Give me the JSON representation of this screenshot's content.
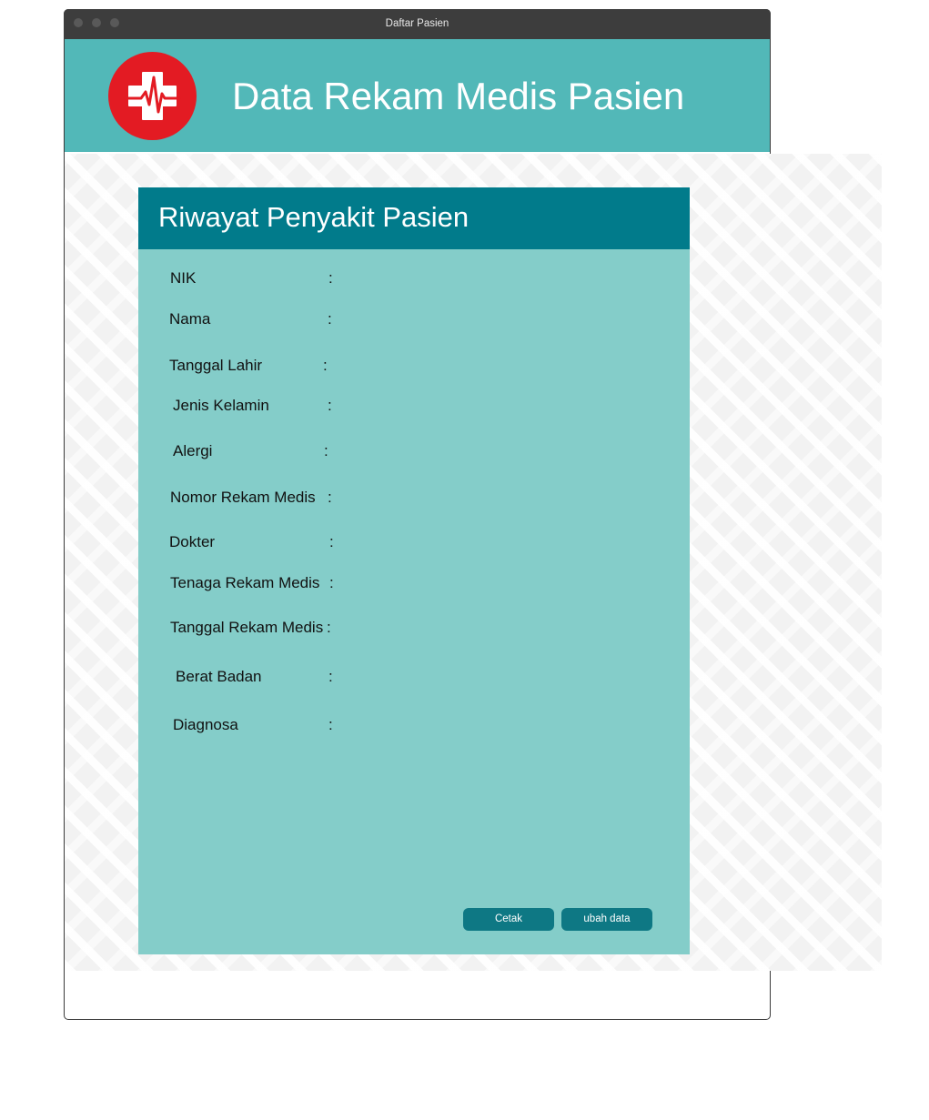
{
  "window": {
    "title": "Daftar Pasien"
  },
  "header": {
    "title": "Data Rekam Medis Pasien",
    "logo_icon": "medical-cross-heartbeat-icon",
    "logo_color": "#e31b23",
    "background": "#52b8b8"
  },
  "panel": {
    "title": "Riwayat Penyakit Pasien",
    "header_color": "#017b8b",
    "body_color": "#84cdc9",
    "fields": [
      {
        "label": "NIK",
        "separator": ":"
      },
      {
        "label": "Nama",
        "separator": ":"
      },
      {
        "label": "Tanggal Lahir",
        "separator": ":"
      },
      {
        "label": "Jenis Kelamin",
        "separator": ":"
      },
      {
        "label": "Alergi",
        "separator": ":"
      },
      {
        "label": "Nomor Rekam Medis",
        "separator": ":"
      },
      {
        "label": "Dokter",
        "separator": ":"
      },
      {
        "label": "Tenaga Rekam Medis",
        "separator": ":"
      },
      {
        "label": "Tanggal Rekam Medis",
        "separator": ":"
      },
      {
        "label": "Berat Badan",
        "separator": ":"
      },
      {
        "label": "Diagnosa",
        "separator": ":"
      }
    ],
    "buttons": {
      "print_label": "Cetak",
      "edit_label": "ubah data",
      "color": "#0e7884"
    }
  }
}
